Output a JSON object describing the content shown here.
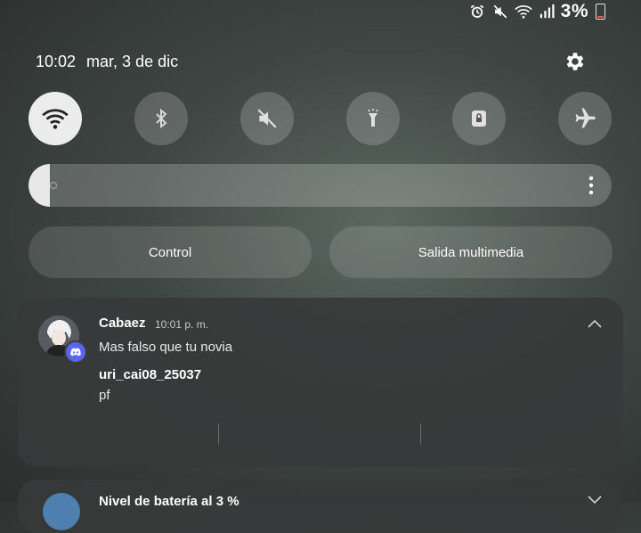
{
  "status_bar": {
    "battery_percent": "3%",
    "icons": [
      "alarm-icon",
      "mute-icon",
      "wifi-icon",
      "signal-icon",
      "battery-icon"
    ]
  },
  "header": {
    "time": "10:02",
    "date": "mar, 3 de dic"
  },
  "quick_toggles": [
    {
      "name": "wifi",
      "icon": "wifi-icon",
      "active": true
    },
    {
      "name": "bluetooth",
      "icon": "bluetooth-icon",
      "active": false
    },
    {
      "name": "sound",
      "icon": "mute-icon",
      "active": false
    },
    {
      "name": "flashlight",
      "icon": "flashlight-icon",
      "active": false
    },
    {
      "name": "secure-folder",
      "icon": "lock-icon",
      "active": false
    },
    {
      "name": "airplane",
      "icon": "airplane-icon",
      "active": false
    }
  ],
  "brightness": {
    "level_fraction": 0.03
  },
  "buttons": {
    "control": "Control",
    "media_output": "Salida multimedia"
  },
  "notification": {
    "app_icon": "discord-icon",
    "sender": "Cabaez",
    "time": "10:01 p. m.",
    "message": "Mas falso que tu novia",
    "username": "uri_cai08_25037",
    "body": "pf"
  },
  "notification2": {
    "title": "Nivel de batería al 3 %"
  },
  "colors": {
    "accent_discord": "#5865f2",
    "toggle_active": "#ececec",
    "battery_low": "#e35a4a"
  }
}
